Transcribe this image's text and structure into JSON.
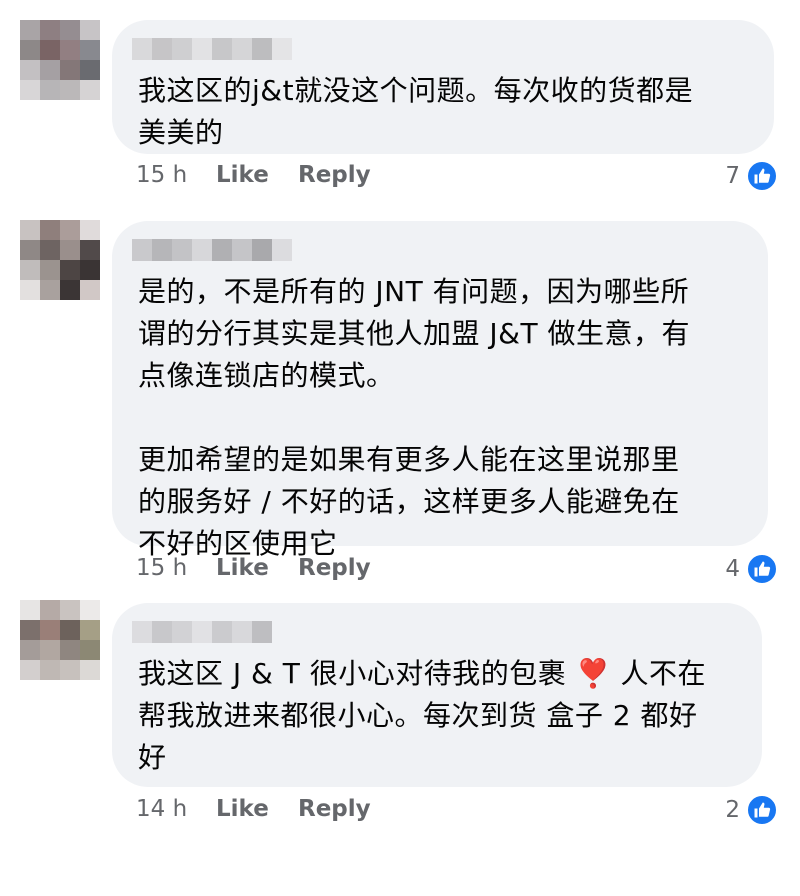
{
  "comments": [
    {
      "text": "我这区的j&t就没这个问题。每次收的货都是\n美美的",
      "time": "15 h",
      "like_label": "Like",
      "reply_label": "Reply",
      "reaction_count": "7"
    },
    {
      "text": "是的，不是所有的 JNT 有问题，因为哪些所\n谓的分行其实是其他人加盟 J&T 做生意，有\n点像连锁店的模式。\n\n更加希望的是如果有更多人能在这里说那里\n的服务好 / 不好的话，这样更多人能避免在\n不好的区使用它",
      "time": "15 h",
      "like_label": "Like",
      "reply_label": "Reply",
      "reaction_count": "4"
    },
    {
      "text": "我这区 J & T 很小心对待我的包裹 ❣️ 人不在\n帮我放进来都很小心。每次到货 盒子 2 都好\n好",
      "time": "14 h",
      "like_label": "Like",
      "reply_label": "Reply",
      "reaction_count": "2"
    }
  ],
  "colors": {
    "bubble": "#f0f2f5",
    "meta_text": "#65676b",
    "like_blue": "#1877f2"
  },
  "icons": {
    "reaction": "thumbs-up-icon"
  }
}
